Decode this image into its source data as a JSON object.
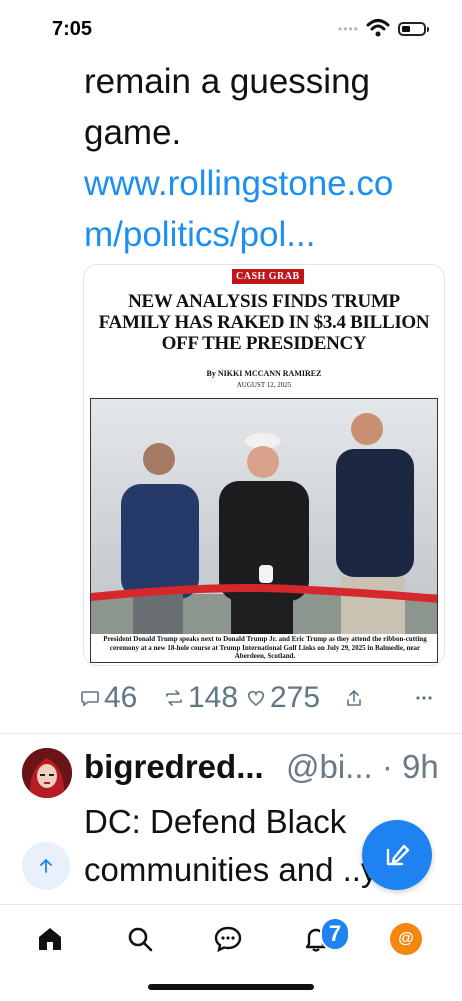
{
  "status": {
    "time": "7:05"
  },
  "post1": {
    "text_lines": [
      "remain a guessing",
      "game."
    ],
    "link_lines": [
      "www.rollingstone.co",
      "m/politics/pol..."
    ],
    "card": {
      "tag": "CASH GRAB",
      "headline": "NEW ANALYSIS FINDS TRUMP FAMILY HAS RAKED IN $3.4 BILLION OFF THE PRESIDENCY",
      "byline": "By NIKKI MCCANN RAMIREZ",
      "date": "AUGUST 12, 2025",
      "caption": "President Donald Trump speaks next to Donald Trump Jr. and Eric Trump as they attend the ribbon-cutting ceremony at a new 18-hole course at Trump International Golf Links on July 29, 2025 in Balmedie, near Aberdeen, Scotland."
    },
    "actions": {
      "replies": "46",
      "reposts": "148",
      "likes": "275"
    }
  },
  "post2": {
    "name": "bigredred...",
    "handle": "@bi...",
    "time": "· 9h",
    "text_lines": [
      "DC: Defend Black",
      "communities and ..y"
    ]
  },
  "tabbar": {
    "notifications_count": "7",
    "profile_symbol": "@"
  },
  "colors": {
    "accent": "#1e83f0",
    "link": "#1d8ff0",
    "muted": "#5f7684",
    "tag_red": "#c0161b",
    "profile": "#f5870f"
  }
}
